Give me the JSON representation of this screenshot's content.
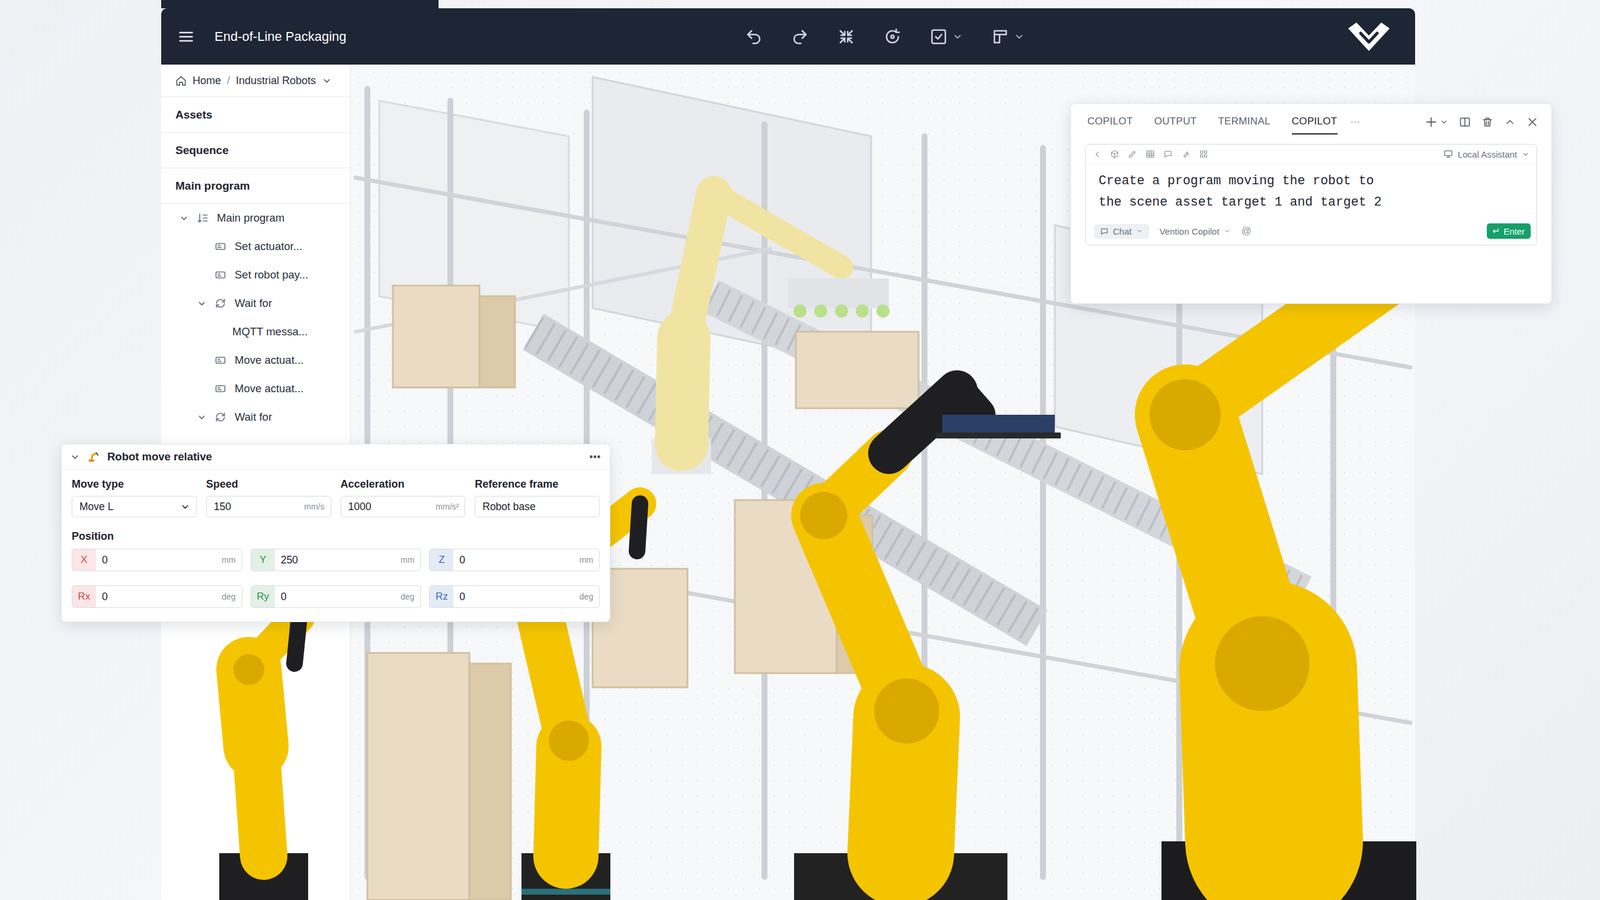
{
  "window": {
    "title": "End-of-Line Packaging"
  },
  "breadcrumb": {
    "items": [
      {
        "label": "Home"
      },
      {
        "label": "Industrial Robots"
      }
    ],
    "separator": "/"
  },
  "sidebar": {
    "sections": [
      {
        "label": "Assets"
      },
      {
        "label": "Sequence"
      },
      {
        "label": "Main program"
      }
    ],
    "tree": [
      {
        "label": "Main program",
        "depth": 0,
        "kind": "sequence",
        "expanded": true
      },
      {
        "label": "Set actuator...",
        "depth": 1,
        "kind": "action"
      },
      {
        "label": "Set robot pay...",
        "depth": 1,
        "kind": "action"
      },
      {
        "label": "Wait for",
        "depth": 1,
        "kind": "loop",
        "expanded": true
      },
      {
        "label": "MQTT messa...",
        "depth": 2,
        "kind": "event"
      },
      {
        "label": "Move actuat...",
        "depth": 1,
        "kind": "action"
      },
      {
        "label": "Move actuat...",
        "depth": 1,
        "kind": "action"
      },
      {
        "label": "Wait for",
        "depth": 1,
        "kind": "loop",
        "expanded": true
      }
    ]
  },
  "copilot": {
    "tabs": [
      {
        "label": "COPILOT",
        "selected": false
      },
      {
        "label": "OUTPUT",
        "selected": false
      },
      {
        "label": "TERMINAL",
        "selected": false
      },
      {
        "label": "COPILOT",
        "selected": true
      }
    ],
    "more": "···",
    "assistant": "Local Assistant",
    "prompt": "Create a program moving the robot to\nthe scene asset target 1 and target 2",
    "mode": "Chat",
    "agent": "Vention Copilot",
    "mention": "@",
    "submit": {
      "glyph": "↵",
      "label": "Enter"
    }
  },
  "move_panel": {
    "title": "Robot move relative",
    "expanded": true,
    "fields": [
      {
        "label": "Move type",
        "value": "Move L",
        "kind": "select"
      },
      {
        "label": "Speed",
        "value": "150",
        "unit": "mm/s",
        "kind": "number"
      },
      {
        "label": "Acceleration",
        "value": "1000",
        "unit": "mm/s²",
        "kind": "number"
      },
      {
        "label": "Reference frame",
        "value": "Robot base",
        "kind": "text"
      }
    ],
    "position_label": "Position",
    "axes": [
      {
        "label": "X",
        "value": "0",
        "unit": "mm",
        "color": "#d64545"
      },
      {
        "label": "Y",
        "value": "250",
        "unit": "mm",
        "color": "#2f8f46"
      },
      {
        "label": "Z",
        "value": "0",
        "unit": "mm",
        "color": "#3b6bb5"
      },
      {
        "label": "Rx",
        "value": "0",
        "unit": "deg",
        "color": "#d64545"
      },
      {
        "label": "Ry",
        "value": "0",
        "unit": "deg",
        "color": "#2f8f46"
      },
      {
        "label": "Rz",
        "value": "0",
        "unit": "deg",
        "color": "#3b6bb5"
      }
    ]
  }
}
